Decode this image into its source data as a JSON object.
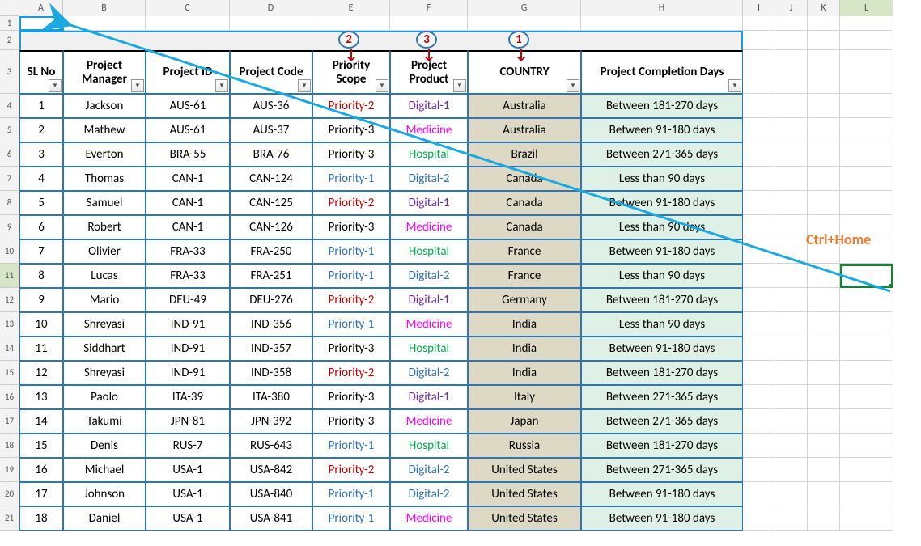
{
  "columns": [
    "A",
    "B",
    "C",
    "D",
    "E",
    "F",
    "G",
    "H",
    "I",
    "J",
    "K",
    "L"
  ],
  "active_col": "L",
  "active_row": 11,
  "headers": {
    "A": "SL No",
    "B": "Project Manager",
    "C": "Project ID",
    "D": "Project Code",
    "E": "Priority Scope",
    "F": "Project Product",
    "G": "COUNTRY",
    "H": "Project Completion Days"
  },
  "annotations": {
    "num2": "2",
    "num3": "3",
    "num1": "1",
    "hint": "Ctrl+Home"
  },
  "rows": [
    {
      "n": "1",
      "mgr": "Jackson",
      "pid": "AUS-61",
      "code": "AUS-36",
      "pri": "Priority-2",
      "pric": "red",
      "prod": "Digital-1",
      "prodc": "purple",
      "ctry": "Australia",
      "days": "Between 181-270 days"
    },
    {
      "n": "2",
      "mgr": "Mathew",
      "pid": "AUS-61",
      "code": "AUS-37",
      "pri": "Priority-3",
      "pric": "black",
      "prod": "Medicine",
      "prodc": "magenta",
      "ctry": "Australia",
      "days": "Between 91-180 days"
    },
    {
      "n": "3",
      "mgr": "Everton",
      "pid": "BRA-55",
      "code": "BRA-76",
      "pri": "Priority-3",
      "pric": "black",
      "prod": "Hospital",
      "prodc": "green",
      "ctry": "Brazil",
      "days": "Between 271-365 days"
    },
    {
      "n": "4",
      "mgr": "Thomas",
      "pid": "CAN-1",
      "code": "CAN-124",
      "pri": "Priority-1",
      "pric": "blue",
      "prod": "Digital-2",
      "prodc": "blue",
      "ctry": "Canada",
      "days": "Less than 90 days"
    },
    {
      "n": "5",
      "mgr": "Samuel",
      "pid": "CAN-1",
      "code": "CAN-125",
      "pri": "Priority-2",
      "pric": "red",
      "prod": "Digital-1",
      "prodc": "purple",
      "ctry": "Canada",
      "days": "Between 91-180 days"
    },
    {
      "n": "6",
      "mgr": "Robert",
      "pid": "CAN-1",
      "code": "CAN-126",
      "pri": "Priority-3",
      "pric": "black",
      "prod": "Medicine",
      "prodc": "magenta",
      "ctry": "Canada",
      "days": "Less than 90 days"
    },
    {
      "n": "7",
      "mgr": "Olivier",
      "pid": "FRA-33",
      "code": "FRA-250",
      "pri": "Priority-1",
      "pric": "blue",
      "prod": "Hospital",
      "prodc": "green",
      "ctry": "France",
      "days": "Between 91-180 days"
    },
    {
      "n": "8",
      "mgr": "Lucas",
      "pid": "FRA-33",
      "code": "FRA-251",
      "pri": "Priority-1",
      "pric": "blue",
      "prod": "Digital-2",
      "prodc": "blue",
      "ctry": "France",
      "days": "Less than 90 days"
    },
    {
      "n": "9",
      "mgr": "Mario",
      "pid": "DEU-49",
      "code": "DEU-276",
      "pri": "Priority-2",
      "pric": "red",
      "prod": "Digital-1",
      "prodc": "purple",
      "ctry": "Germany",
      "days": "Between 181-270 days"
    },
    {
      "n": "10",
      "mgr": "Shreyasi",
      "pid": "IND-91",
      "code": "IND-356",
      "pri": "Priority-1",
      "pric": "blue",
      "prod": "Medicine",
      "prodc": "magenta",
      "ctry": "India",
      "days": "Less than 90 days"
    },
    {
      "n": "11",
      "mgr": "Siddhart",
      "pid": "IND-91",
      "code": "IND-357",
      "pri": "Priority-3",
      "pric": "black",
      "prod": "Hospital",
      "prodc": "green",
      "ctry": "India",
      "days": "Between 91-180 days"
    },
    {
      "n": "12",
      "mgr": "Shreyasi",
      "pid": "IND-91",
      "code": "IND-358",
      "pri": "Priority-2",
      "pric": "red",
      "prod": "Digital-2",
      "prodc": "blue",
      "ctry": "India",
      "days": "Between 181-270 days"
    },
    {
      "n": "13",
      "mgr": "Paolo",
      "pid": "ITA-39",
      "code": "ITA-380",
      "pri": "Priority-3",
      "pric": "black",
      "prod": "Digital-1",
      "prodc": "purple",
      "ctry": "Italy",
      "days": "Between 271-365 days"
    },
    {
      "n": "14",
      "mgr": "Takumi",
      "pid": "JPN-81",
      "code": "JPN-392",
      "pri": "Priority-3",
      "pric": "black",
      "prod": "Medicine",
      "prodc": "magenta",
      "ctry": "Japan",
      "days": "Between 271-365 days"
    },
    {
      "n": "15",
      "mgr": "Denis",
      "pid": "RUS-7",
      "code": "RUS-643",
      "pri": "Priority-1",
      "pric": "blue",
      "prod": "Hospital",
      "prodc": "green",
      "ctry": "Russia",
      "days": "Between 181-270 days"
    },
    {
      "n": "16",
      "mgr": "Michael",
      "pid": "USA-1",
      "code": "USA-842",
      "pri": "Priority-2",
      "pric": "red",
      "prod": "Digital-2",
      "prodc": "blue",
      "ctry": "United States",
      "days": "Between 271-365 days"
    },
    {
      "n": "17",
      "mgr": "Johnson",
      "pid": "USA-1",
      "code": "USA-840",
      "pri": "Priority-1",
      "pric": "blue",
      "prod": "Digital-2",
      "prodc": "blue",
      "ctry": "United States",
      "days": "Between 91-180 days"
    },
    {
      "n": "18",
      "mgr": "Daniel",
      "pid": "USA-1",
      "code": "USA-841",
      "pri": "Priority-1",
      "pric": "blue",
      "prod": "Medicine",
      "prodc": "magenta",
      "ctry": "United States",
      "days": "Between 91-180 days"
    }
  ]
}
